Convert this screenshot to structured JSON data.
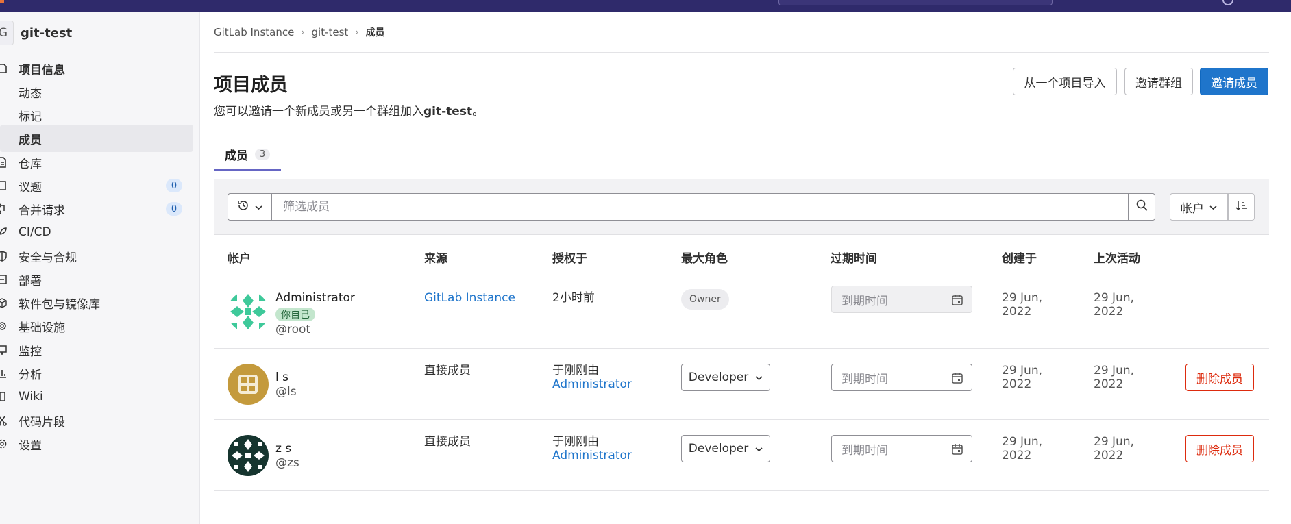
{
  "project": {
    "avatar_letter": "G",
    "name": "git-test"
  },
  "sidebar": {
    "items": [
      {
        "label": "项目信息",
        "icon": "info-icon",
        "bold": true
      },
      {
        "label": "动态"
      },
      {
        "label": "标记"
      },
      {
        "label": "成员",
        "active": true
      },
      {
        "label": "仓库",
        "icon": "document-icon"
      },
      {
        "label": "议题",
        "icon": "issues-icon",
        "count": "0"
      },
      {
        "label": "合并请求",
        "icon": "merge-request-icon",
        "count": "0"
      },
      {
        "label": "CI/CD",
        "icon": "rocket-icon"
      },
      {
        "label": "安全与合规",
        "icon": "shield-icon"
      },
      {
        "label": "部署",
        "icon": "deployments-icon"
      },
      {
        "label": "软件包与镜像库",
        "icon": "package-icon"
      },
      {
        "label": "基础设施",
        "icon": "cloud-gear-icon"
      },
      {
        "label": "监控",
        "icon": "monitor-icon"
      },
      {
        "label": "分析",
        "icon": "chart-icon"
      },
      {
        "label": "Wiki",
        "icon": "book-icon"
      },
      {
        "label": "代码片段",
        "icon": "snippet-icon"
      },
      {
        "label": "设置",
        "icon": "gear-icon"
      }
    ]
  },
  "breadcrumb": {
    "items": [
      "GitLab Instance",
      "git-test"
    ],
    "current": "成员"
  },
  "page": {
    "title": "项目成员",
    "desc_prefix": "您可以邀请一个新成员或另一个群组加入",
    "desc_project": "git-test",
    "desc_suffix": "。"
  },
  "actions": {
    "import": "从一个项目导入",
    "invite_group": "邀请群组",
    "invite_member": "邀请成员"
  },
  "tabs": [
    {
      "label": "成员",
      "count": "3"
    }
  ],
  "filter": {
    "placeholder": "筛选成员",
    "sort_label": "帐户"
  },
  "table": {
    "headers": [
      "帐户",
      "来源",
      "授权于",
      "最大角色",
      "过期时间",
      "创建于",
      "上次活动"
    ],
    "rows": [
      {
        "name": "Administrator",
        "badge": "你自己",
        "handle": "@root",
        "source": "GitLab Instance",
        "granted": "2小时前",
        "role": "Owner",
        "expires_placeholder": "到期时间",
        "created": "29 Jun,",
        "created_year": "2022",
        "last_activity": "29 Jun,",
        "last_activity_year": "2022"
      },
      {
        "name": "l s",
        "handle": "@ls",
        "source": "直接成员",
        "granted_prefix": "于刚刚由",
        "granted_by": "Administrator",
        "role": "Developer",
        "expires_placeholder": "到期时间",
        "created": "29 Jun,",
        "created_year": "2022",
        "last_activity": "29 Jun,",
        "last_activity_year": "2022",
        "remove": "删除成员"
      },
      {
        "name": "z s",
        "handle": "@zs",
        "source": "直接成员",
        "granted_prefix": "于刚刚由",
        "granted_by": "Administrator",
        "role": "Developer",
        "expires_placeholder": "到期时间",
        "created": "29 Jun,",
        "created_year": "2022",
        "last_activity": "29 Jun,",
        "last_activity_year": "2022",
        "remove": "删除成员"
      }
    ]
  },
  "colors": {
    "brand": "#2f2a6b",
    "primary": "#1f75cb",
    "danger": "#dd2b0e",
    "tab_underline": "#6666c4"
  }
}
